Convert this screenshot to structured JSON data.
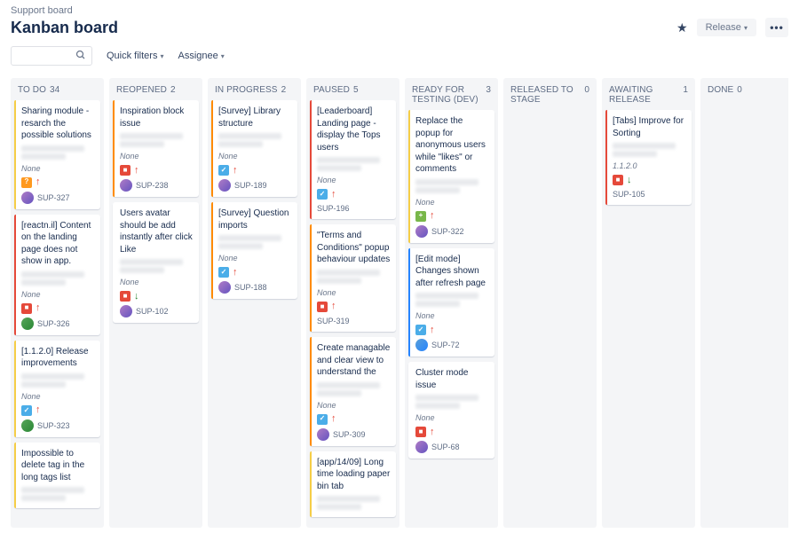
{
  "breadcrumb": "Support board",
  "title": "Kanban board",
  "header": {
    "release": "Release",
    "more": "•••"
  },
  "toolbar": {
    "search_placeholder": "",
    "quick_filters": "Quick filters",
    "assignee": "Assignee"
  },
  "colors": {
    "bug": "#e5493a",
    "task": "#4bade8",
    "newfeature": "#79b74a",
    "question": "#ff991f",
    "prio_up": "#e5493a",
    "prio_down": "#2a8735",
    "stripe_yellow": "#f5cd47",
    "stripe_orange": "#ff8b00",
    "stripe_red": "#e5493a",
    "stripe_blue": "#2684ff",
    "avatar_a": "linear-gradient(135deg,#b07cc6,#6554c0)",
    "avatar_b": "linear-gradient(135deg,#57a55a,#2a8735)",
    "avatar_c": "linear-gradient(135deg,#5aa0d8,#2684ff)"
  },
  "columns": [
    {
      "name": "TO DO",
      "count": 34
    },
    {
      "name": "REOPENED",
      "count": 2
    },
    {
      "name": "IN PROGRESS",
      "count": 2
    },
    {
      "name": "PAUSED",
      "count": 5
    },
    {
      "name": "READY FOR TESTING (DEV)",
      "count": 3
    },
    {
      "name": "RELEASED TO STAGE",
      "count": 0
    },
    {
      "name": "AWAITING RELEASE",
      "count": 1
    },
    {
      "name": "DONE",
      "count": 0
    }
  ],
  "cards": {
    "todo": [
      {
        "title": "Sharing module - resarch the possible solutions",
        "version": "None",
        "type": "question",
        "prio": "up",
        "avatar": "a",
        "key": "SUP-327",
        "stripe": "yellow"
      },
      {
        "title": "[reactn.il] Content on the landing page does not show in app.",
        "version": "None",
        "type": "bug",
        "prio": "up",
        "avatar": "b",
        "key": "SUP-326",
        "stripe": "red"
      },
      {
        "title": "[1.1.2.0] Release improvements",
        "version": "None",
        "type": "task",
        "prio": "up",
        "avatar": "b",
        "key": "SUP-323",
        "stripe": "yellow"
      },
      {
        "title": "Impossible to delete tag in the long tags list",
        "version": "",
        "type": "",
        "prio": "",
        "avatar": "",
        "key": "",
        "stripe": "yellow"
      }
    ],
    "reopened": [
      {
        "title": "Inspiration block issue",
        "version": "None",
        "type": "bug",
        "prio": "up",
        "avatar": "a",
        "key": "SUP-238",
        "stripe": "orange"
      },
      {
        "title": "Users avatar should be add instantly after click Like",
        "version": "None",
        "type": "bug",
        "prio": "down",
        "avatar": "a",
        "key": "SUP-102",
        "stripe": ""
      }
    ],
    "inprogress": [
      {
        "title": "[Survey] Library structure",
        "version": "None",
        "type": "task",
        "prio": "up",
        "avatar": "a",
        "key": "SUP-189",
        "stripe": "orange"
      },
      {
        "title": "[Survey] Question imports",
        "version": "None",
        "type": "task",
        "prio": "up",
        "avatar": "a",
        "key": "SUP-188",
        "stripe": "orange"
      }
    ],
    "paused": [
      {
        "title": "[Leaderboard] Landing page - display the Tops users",
        "version": "None",
        "type": "task",
        "prio": "up",
        "avatar": "",
        "key": "SUP-196",
        "stripe": "red"
      },
      {
        "title": "\"Terms and Conditions\" popup behaviour updates",
        "version": "None",
        "type": "bug",
        "prio": "up",
        "avatar": "",
        "key": "SUP-319",
        "stripe": "orange"
      },
      {
        "title": "Create managable and clear view to understand the",
        "version": "None",
        "type": "task",
        "prio": "up",
        "avatar": "a",
        "key": "SUP-309",
        "stripe": "orange"
      },
      {
        "title": "[app/14/09] Long time loading paper bin tab",
        "version": "",
        "type": "",
        "prio": "",
        "avatar": "",
        "key": "",
        "stripe": "yellow"
      }
    ],
    "ready": [
      {
        "title": "Replace the popup for anonymous users while \"likes\" or comments",
        "version": "None",
        "type": "newfeature",
        "prio": "up",
        "avatar": "a",
        "key": "SUP-322",
        "stripe": "yellow"
      },
      {
        "title": "[Edit mode] Changes shown after refresh page",
        "version": "None",
        "type": "task",
        "prio": "up",
        "avatar": "c",
        "key": "SUP-72",
        "stripe": "blue"
      },
      {
        "title": "Cluster mode issue",
        "version": "None",
        "type": "bug",
        "prio": "up",
        "avatar": "a",
        "key": "SUP-68",
        "stripe": ""
      }
    ],
    "awaiting": [
      {
        "title": "[Tabs] Improve for Sorting",
        "version": "1.1.2.0",
        "type": "bug",
        "prio": "down",
        "avatar": "",
        "key": "SUP-105",
        "stripe": "red"
      }
    ]
  }
}
